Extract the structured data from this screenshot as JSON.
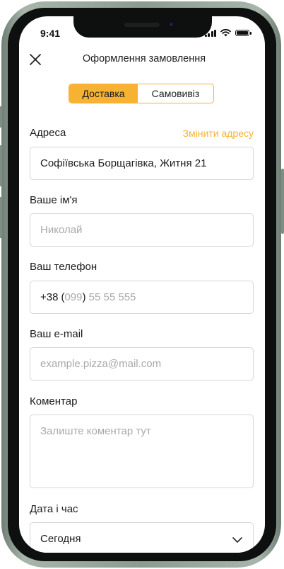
{
  "status_bar": {
    "time": "9:41"
  },
  "header": {
    "title": "Оформлення замовлення"
  },
  "tabs": [
    {
      "label": "Доставка",
      "active": true
    },
    {
      "label": "Самовивіз",
      "active": false
    }
  ],
  "form": {
    "address": {
      "label": "Адреса",
      "change_link": "Змінити адресу",
      "value": "Софіївська Борщагівка, Житня 21"
    },
    "name": {
      "label": "Ваше ім'я",
      "placeholder": "Николай"
    },
    "phone": {
      "label": "Ваш телефон",
      "prefix": "+38",
      "open_paren": "(",
      "code": "099",
      "close_paren": ")",
      "number": " 55 55 555"
    },
    "email": {
      "label": "Ваш e-mail",
      "placeholder": "example.pizza@mail.com"
    },
    "comment": {
      "label": "Коментар",
      "placeholder": "Залиште коментар тут"
    },
    "datetime": {
      "label": "Дата і час",
      "value": "Сегодня"
    }
  },
  "colors": {
    "accent": "#f7b233",
    "frame": "#8c9b90",
    "border": "#d6d6d6",
    "placeholder": "#a9a9a9"
  },
  "icons": {
    "close": "close-icon",
    "chevron": "chevron-down-icon"
  }
}
